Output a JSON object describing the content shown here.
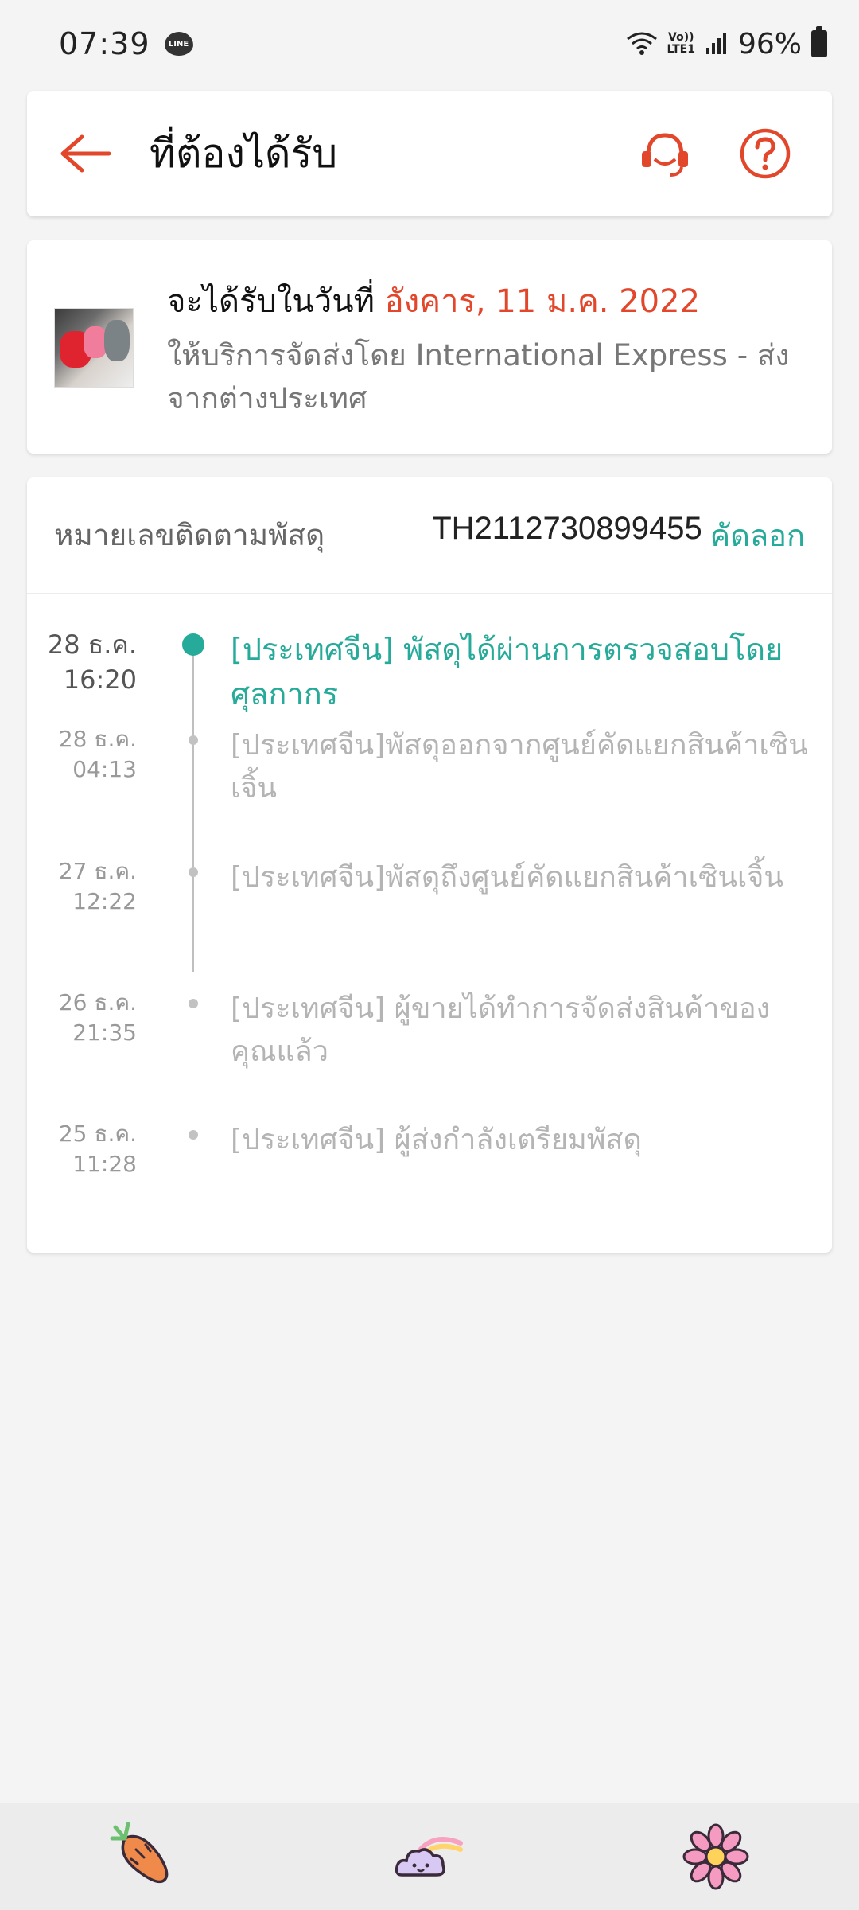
{
  "status_bar": {
    "time": "07:39",
    "line_badge": "LINE",
    "volte_line1": "Vo))",
    "volte_line2": "LTE1",
    "battery": "96%"
  },
  "header": {
    "title": "ที่ต้องได้รับ",
    "icons": [
      "back-arrow-icon",
      "headset-icon",
      "help-circle-icon"
    ]
  },
  "delivery": {
    "prefix": "จะได้รับในวันที่",
    "date": "อังคาร, 11 ม.ค. 2022",
    "carrier_text": "ให้บริการจัดส่งโดย International Express - ส่งจากต่างประเทศ"
  },
  "tracking": {
    "label": "หมายเลขติดตามพัสดุ",
    "number": "TH2112730899455",
    "copy_label": "คัดลอก",
    "events": [
      {
        "date": "28 ธ.ค.",
        "time": "16:20",
        "text": "[ประเทศจีน] พัสดุได้ผ่านการตรวจสอบโดยศุลกากร"
      },
      {
        "date": "28 ธ.ค.",
        "time": "04:13",
        "text": "[ประเทศจีน]พัสดุออกจากศูนย์คัดแยกสินค้าเซินเจิ้น"
      },
      {
        "date": "27 ธ.ค.",
        "time": "12:22",
        "text": "[ประเทศจีน]พัสดุถึงศูนย์คัดแยกสินค้าเซินเจิ้น"
      },
      {
        "date": "26 ธ.ค.",
        "time": "21:35",
        "text": "[ประเทศจีน] ผู้ขายได้ทำการจัดส่งสินค้าของคุณแล้ว"
      },
      {
        "date": "25 ธ.ค.",
        "time": "11:28",
        "text": "[ประเทศจีน] ผู้ส่งกำลังเตรียมพัสดุ"
      }
    ]
  },
  "colors": {
    "accent": "#e2472b",
    "teal": "#26aa99"
  },
  "bottom_nav": [
    "carrot-icon",
    "rainbow-cloud-icon",
    "flower-icon"
  ]
}
